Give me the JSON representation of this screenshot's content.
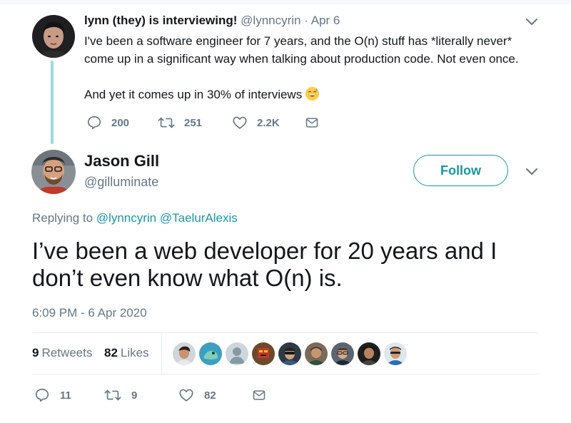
{
  "parent_tweet": {
    "display_name": "lynn (they) is interviewing!",
    "handle": "@lynncyrin",
    "separator": "·",
    "date": "Apr 6",
    "body_lines": [
      "I've been a software engineer for 7 years, and the O(n) stuff has *literally never*",
      "come up in a significant way when talking about production code. Not even once.",
      "And yet it comes up in 30% of interviews"
    ],
    "emoji": "grinning-sweat-emoji",
    "actions": {
      "replies": "200",
      "retweets": "251",
      "likes": "2.2K"
    }
  },
  "main_tweet": {
    "display_name": "Jason Gill",
    "handle": "@gilluminate",
    "follow_label": "Follow",
    "replying_prefix": "Replying to",
    "replying_to": [
      "@lynncyrin",
      "@TaelurAlexis"
    ],
    "body_lines": [
      "I’ve been a web developer for 20 years and I",
      "don’t even know what O(n) is."
    ],
    "timestamp": "6:09 PM - 6 Apr 2020",
    "stats": {
      "retweets_count": "9",
      "retweets_label": "Retweets",
      "likes_count": "82",
      "likes_label": "Likes"
    },
    "actions": {
      "replies": "11",
      "retweets": "9",
      "likes": "82"
    }
  },
  "colors": {
    "accent": "#1b95a6",
    "thread_line": "#9fd8df",
    "muted_text": "#657786",
    "divider": "#e6ecf0"
  }
}
